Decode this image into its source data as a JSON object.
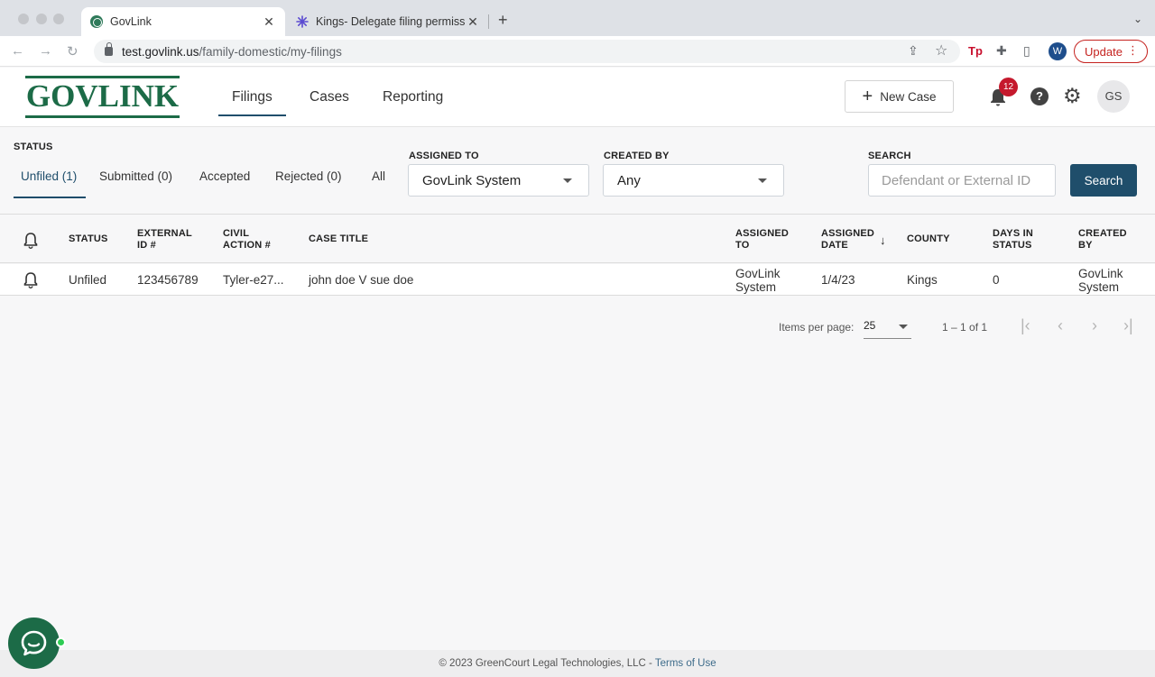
{
  "browser": {
    "tabs": [
      {
        "title": "GovLink",
        "active": true
      },
      {
        "title": "Kings- Delegate filing permissi",
        "active": false
      }
    ],
    "url_host": "test.govlink.us",
    "url_path": "/family-domestic/my-filings",
    "profile_initial": "W",
    "update_label": "Update",
    "ext_label": "Tp"
  },
  "header": {
    "logo_text": "GOVLINK",
    "nav": [
      {
        "label": "Filings",
        "active": true
      },
      {
        "label": "Cases",
        "active": false
      },
      {
        "label": "Reporting",
        "active": false
      }
    ],
    "new_case_label": "New Case",
    "notification_count": "12",
    "avatar_initials": "GS"
  },
  "filters": {
    "status_label": "STATUS",
    "status_tabs": [
      "Unfiled (1)",
      "Submitted (0)",
      "Accepted",
      "Rejected (0)",
      "All"
    ],
    "assigned_to_label": "ASSIGNED TO",
    "assigned_to_value": "GovLink System",
    "created_by_label": "CREATED BY",
    "created_by_value": "Any",
    "search_label": "SEARCH",
    "search_placeholder": "Defendant or External ID",
    "search_button": "Search"
  },
  "table": {
    "columns": [
      "STATUS",
      "EXTERNAL ID #",
      "CIVIL ACTION #",
      "CASE TITLE",
      "ASSIGNED TO",
      "ASSIGNED DATE",
      "COUNTY",
      "DAYS IN STATUS",
      "CREATED BY"
    ],
    "rows": [
      {
        "status": "Unfiled",
        "external_id": "123456789",
        "civil_action": "Tyler-e27...",
        "case_title": "john doe V sue doe",
        "assigned_to": "GovLink System",
        "assigned_date": "1/4/23",
        "county": "Kings",
        "days_in_status": "0",
        "created_by": "GovLink System"
      }
    ]
  },
  "pagination": {
    "items_per_page_label": "Items per page:",
    "items_per_page": "25",
    "range": "1 – 1 of 1"
  },
  "footer": {
    "copyright": "© 2023 GreenCourt Legal Technologies, LLC - ",
    "terms": "Terms of Use"
  },
  "colors": {
    "brand_green": "#1c6b47",
    "primary_navy": "#1f4e6b",
    "badge_red": "#c5192d"
  }
}
